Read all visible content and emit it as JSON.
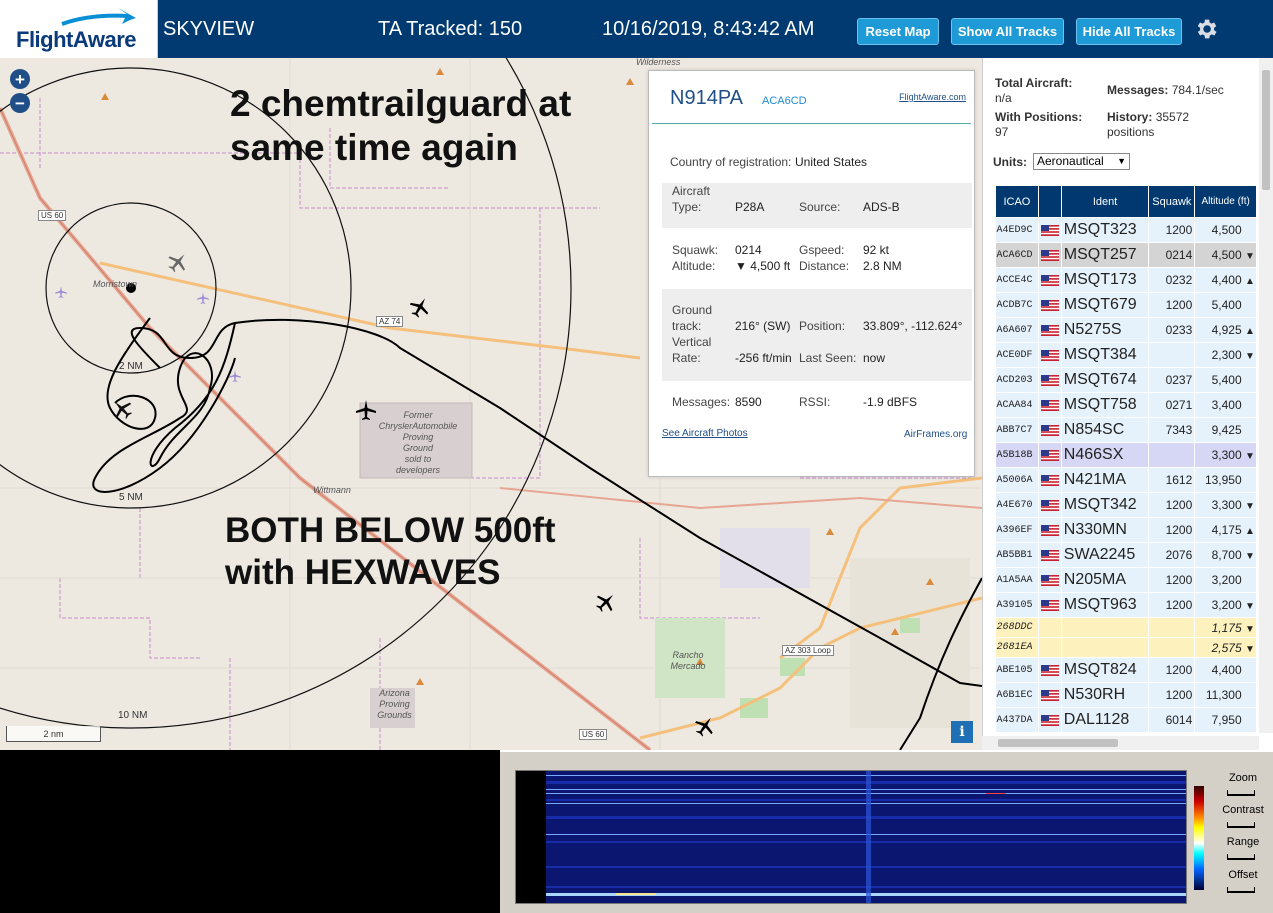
{
  "header": {
    "logo_text": "FlightAware",
    "app_name": "SKYVIEW",
    "tracked": "TA Tracked: 150",
    "datetime": "10/16/2019, 8:43:42 AM",
    "buttons": {
      "reset_map": "Reset Map",
      "show_all": "Show All Tracks",
      "hide_all": "Hide All Tracks"
    },
    "settings_icon": "gear-icon"
  },
  "map": {
    "zoom_in": "+",
    "zoom_out": "−",
    "annotation_top": [
      "2 chemtrailguard at",
      "same time again"
    ],
    "annotation_bottom": [
      "BOTH BELOW 500ft",
      "with HEXWAVES"
    ],
    "range_labels": {
      "r2": "2 NM",
      "r5": "5 NM",
      "r10": "10 NM"
    },
    "places": {
      "wilderness": "Wilderness",
      "morristown": "Morristown",
      "wittmann": "Wittmann",
      "chrysler": [
        "Former",
        "ChryslerAutomobile",
        "Proving",
        "Ground",
        "sold to",
        "developers"
      ],
      "rancho": [
        "Rancho",
        "Mercado"
      ],
      "arizona": [
        "Arizona",
        "Proving",
        "Grounds"
      ]
    },
    "roads": {
      "us60_a": "US 60",
      "az74": "AZ 74",
      "az303": "AZ 303 Loop",
      "us60_b": "US 60"
    },
    "scale": "2 nm",
    "info_button": "i"
  },
  "popup": {
    "registration": "N914PA",
    "icao": "ACA6CD",
    "fa_link": "FlightAware.com",
    "country_label": "Country of registration:",
    "country": "United States",
    "aircraft_label": [
      "Aircraft",
      "Type:"
    ],
    "aircraft_type": "P28A",
    "source_label": "Source:",
    "source": "ADS-B",
    "squawk_label": "Squawk:",
    "squawk": "0214",
    "altitude_label": "Altitude:",
    "altitude": "▼ 4,500 ft",
    "gspeed_label": "Gspeed:",
    "gspeed": "92 kt",
    "distance_label": "Distance:",
    "distance": "2.8 NM",
    "ground_track_label": [
      "Ground",
      "track:"
    ],
    "ground_track": "216° (SW)",
    "position_label": "Position:",
    "position": "33.809°, -112.624°",
    "vrate_label": [
      "Vertical",
      "Rate:"
    ],
    "vrate": "-256 ft/min",
    "last_seen_label": "Last Seen:",
    "last_seen": "now",
    "messages_label": "Messages:",
    "messages": "8590",
    "rssi_label": "RSSI:",
    "rssi": "-1.9 dBFS",
    "photos_link": "See Aircraft Photos",
    "airframes_link": "AirFrames.org"
  },
  "panel": {
    "total_label": "Total Aircraft:",
    "total": "n/a",
    "messages_label": "Messages:",
    "messages": "784.1/sec",
    "with_pos_label": "With Positions:",
    "with_pos": "97",
    "history_label": "History:",
    "history": "35572",
    "history_unit": "positions",
    "units_label": "Units:",
    "units_value": "Aeronautical",
    "columns": [
      "ICAO",
      "",
      "Ident",
      "Squawk",
      "Altitude (ft)"
    ],
    "rows": [
      {
        "icao": "A4ED9C",
        "ident": "MSQT323",
        "squawk": "1200",
        "alt": "4,500",
        "trend": ""
      },
      {
        "icao": "ACA6CD",
        "ident": "MSQT257",
        "squawk": "0214",
        "alt": "4,500",
        "trend": "▼"
      },
      {
        "icao": "ACCE4C",
        "ident": "MSQT173",
        "squawk": "0232",
        "alt": "4,400",
        "trend": "▲"
      },
      {
        "icao": "ACDB7C",
        "ident": "MSQT679",
        "squawk": "1200",
        "alt": "5,400",
        "trend": ""
      },
      {
        "icao": "A6A607",
        "ident": "N5275S",
        "squawk": "0233",
        "alt": "4,925",
        "trend": "▲"
      },
      {
        "icao": "ACE0DF",
        "ident": "MSQT384",
        "squawk": "",
        "alt": "2,300",
        "trend": "▼"
      },
      {
        "icao": "ACD203",
        "ident": "MSQT674",
        "squawk": "0237",
        "alt": "5,400",
        "trend": ""
      },
      {
        "icao": "ACAA84",
        "ident": "MSQT758",
        "squawk": "0271",
        "alt": "3,400",
        "trend": ""
      },
      {
        "icao": "ABB7C7",
        "ident": "N854SC",
        "squawk": "7343",
        "alt": "9,425",
        "trend": ""
      },
      {
        "icao": "A5B18B",
        "ident": "N466SX",
        "squawk": "",
        "alt": "3,300",
        "trend": "▼"
      },
      {
        "icao": "A5006A",
        "ident": "N421MA",
        "squawk": "1612",
        "alt": "13,950",
        "trend": ""
      },
      {
        "icao": "A4E670",
        "ident": "MSQT342",
        "squawk": "1200",
        "alt": "3,300",
        "trend": "▼"
      },
      {
        "icao": "A396EF",
        "ident": "N330MN",
        "squawk": "1200",
        "alt": "4,175",
        "trend": "▲"
      },
      {
        "icao": "AB5BB1",
        "ident": "SWA2245",
        "squawk": "2076",
        "alt": "8,700",
        "trend": "▼"
      },
      {
        "icao": "A1A5AA",
        "ident": "N205MA",
        "squawk": "1200",
        "alt": "3,200",
        "trend": ""
      },
      {
        "icao": "A39105",
        "ident": "MSQT963",
        "squawk": "1200",
        "alt": "3,200",
        "trend": "▼"
      },
      {
        "icao": "268DDC",
        "ident": "",
        "squawk": "",
        "alt": "1,175",
        "trend": "▼"
      },
      {
        "icao": "2681EA",
        "ident": "",
        "squawk": "",
        "alt": "2,575",
        "trend": "▼"
      },
      {
        "icao": "ABE105",
        "ident": "MSQT824",
        "squawk": "1200",
        "alt": "4,400",
        "trend": ""
      },
      {
        "icao": "A6B1EC",
        "ident": "N530RH",
        "squawk": "1200",
        "alt": "11,300",
        "trend": ""
      },
      {
        "icao": "A437DA",
        "ident": "DAL1128",
        "squawk": "6014",
        "alt": "7,950",
        "trend": ""
      }
    ]
  },
  "spectrum": {
    "zoom": "Zoom",
    "contrast": "Contrast",
    "range": "Range",
    "offset": "Offset"
  }
}
